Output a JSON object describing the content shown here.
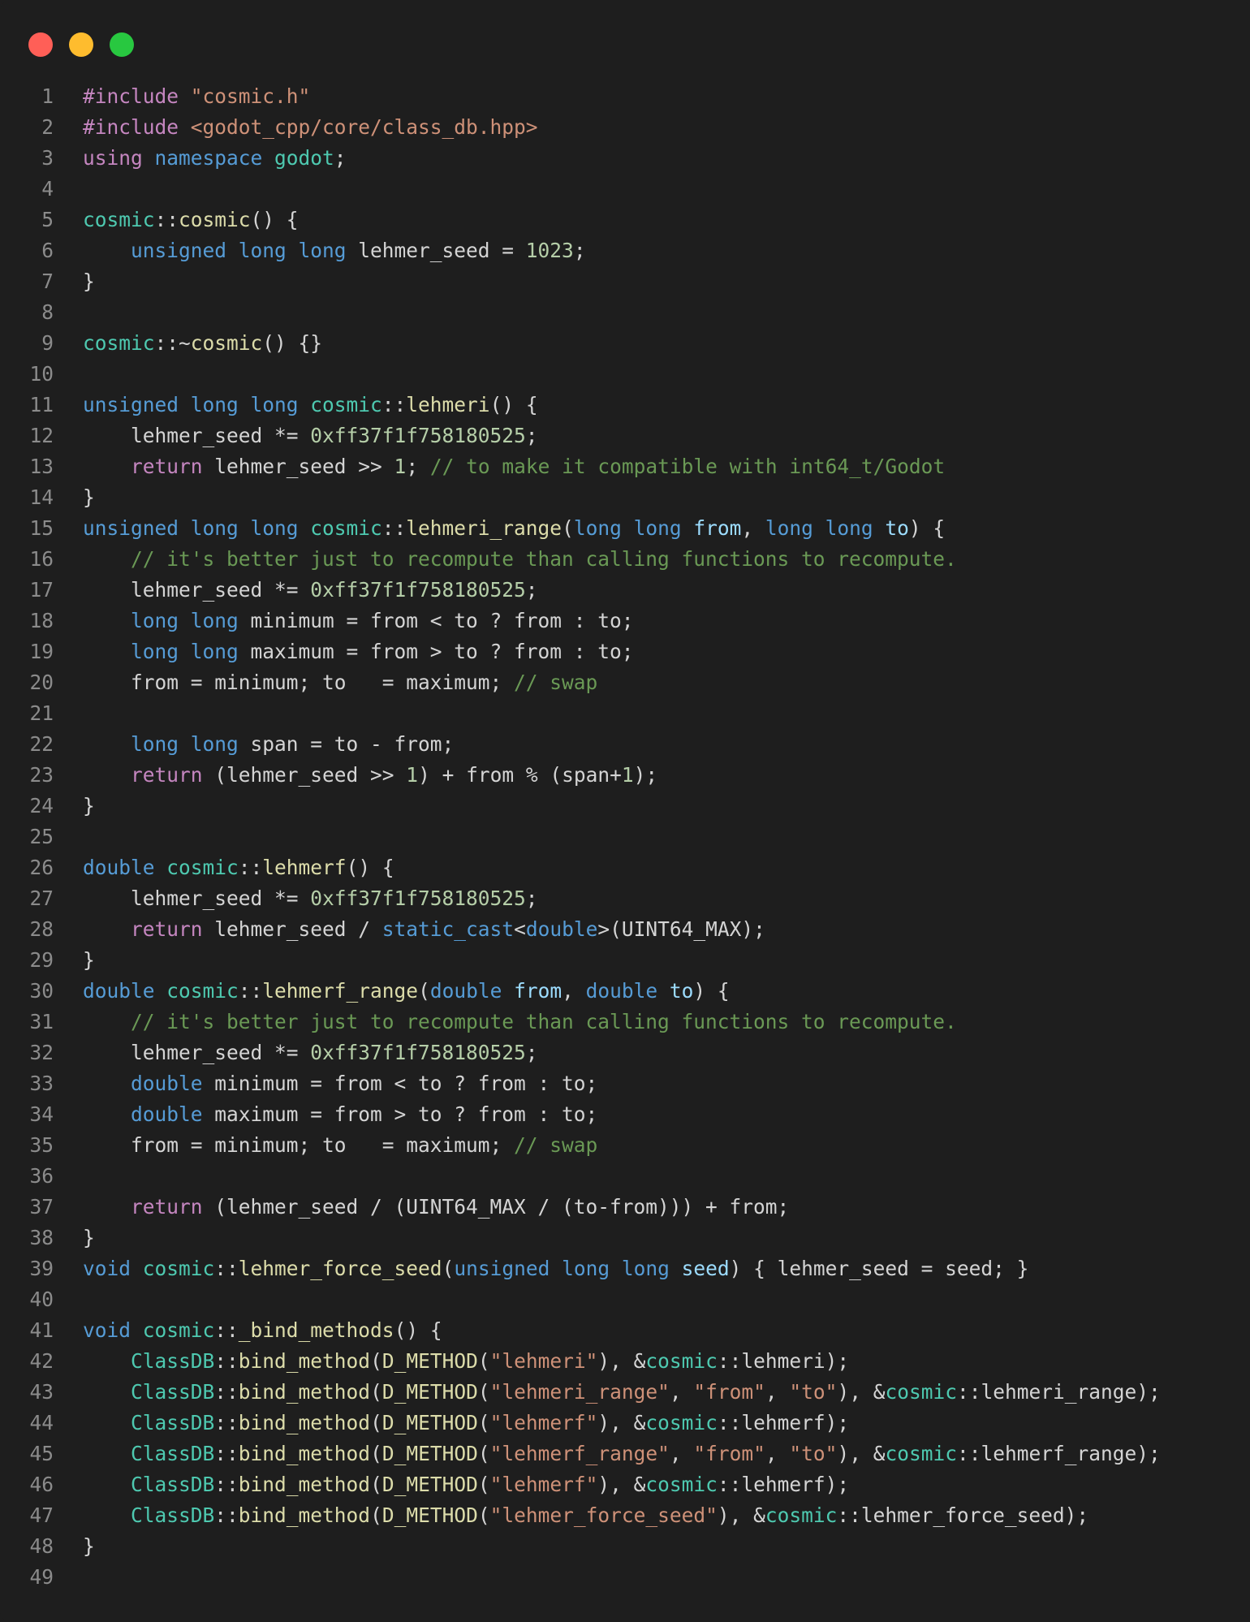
{
  "window": {
    "controls": [
      {
        "name": "close",
        "color": "#ff5f57"
      },
      {
        "name": "minimize",
        "color": "#febc2e"
      },
      {
        "name": "zoom",
        "color": "#28c840"
      }
    ]
  },
  "colors": {
    "background": "#1e1e1e",
    "keyword": "#c586c0",
    "type": "#569cd6",
    "namespace": "#4ec9b0",
    "function": "#dcdcaa",
    "string": "#ce9178",
    "number": "#b5cea8",
    "comment": "#6a9955",
    "variable": "#9cdcfe",
    "plain": "#d4d4d4",
    "line_number": "#8b8b8b"
  },
  "code": {
    "lines": [
      {
        "n": "1",
        "tokens": [
          [
            "kw",
            "#include "
          ],
          [
            "str",
            "\"cosmic.h\""
          ]
        ]
      },
      {
        "n": "2",
        "tokens": [
          [
            "kw",
            "#include "
          ],
          [
            "str",
            "<godot_cpp/core/class_db.hpp>"
          ]
        ]
      },
      {
        "n": "3",
        "tokens": [
          [
            "kw",
            "using "
          ],
          [
            "type",
            "namespace "
          ],
          [
            "ns",
            "godot"
          ],
          [
            "plain",
            ";"
          ]
        ]
      },
      {
        "n": "4",
        "tokens": []
      },
      {
        "n": "5",
        "tokens": [
          [
            "ns",
            "cosmic"
          ],
          [
            "plain",
            "::"
          ],
          [
            "fn",
            "cosmic"
          ],
          [
            "plain",
            "() {"
          ]
        ]
      },
      {
        "n": "6",
        "tokens": [
          [
            "plain",
            "    "
          ],
          [
            "type",
            "unsigned long long "
          ],
          [
            "plain",
            "lehmer_seed = "
          ],
          [
            "num",
            "1023"
          ],
          [
            "plain",
            ";"
          ]
        ]
      },
      {
        "n": "7",
        "tokens": [
          [
            "plain",
            "}"
          ]
        ]
      },
      {
        "n": "8",
        "tokens": []
      },
      {
        "n": "9",
        "tokens": [
          [
            "ns",
            "cosmic"
          ],
          [
            "plain",
            "::~"
          ],
          [
            "fn",
            "cosmic"
          ],
          [
            "plain",
            "() {}"
          ]
        ]
      },
      {
        "n": "10",
        "tokens": []
      },
      {
        "n": "11",
        "tokens": [
          [
            "type",
            "unsigned long long "
          ],
          [
            "ns",
            "cosmic"
          ],
          [
            "plain",
            "::"
          ],
          [
            "fn",
            "lehmeri"
          ],
          [
            "plain",
            "() {"
          ]
        ]
      },
      {
        "n": "12",
        "tokens": [
          [
            "plain",
            "    lehmer_seed *= "
          ],
          [
            "num",
            "0xff37f1f758180525"
          ],
          [
            "plain",
            ";"
          ]
        ]
      },
      {
        "n": "13",
        "tokens": [
          [
            "plain",
            "    "
          ],
          [
            "kw",
            "return "
          ],
          [
            "plain",
            "lehmer_seed >> "
          ],
          [
            "num",
            "1"
          ],
          [
            "plain",
            "; "
          ],
          [
            "cmt",
            "// to make it compatible with int64_t/Godot"
          ]
        ]
      },
      {
        "n": "14",
        "tokens": [
          [
            "plain",
            "}"
          ]
        ]
      },
      {
        "n": "15",
        "tokens": [
          [
            "type",
            "unsigned long long "
          ],
          [
            "ns",
            "cosmic"
          ],
          [
            "plain",
            "::"
          ],
          [
            "fn",
            "lehmeri_range"
          ],
          [
            "plain",
            "("
          ],
          [
            "type",
            "long long "
          ],
          [
            "var",
            "from"
          ],
          [
            "plain",
            ", "
          ],
          [
            "type",
            "long long "
          ],
          [
            "var",
            "to"
          ],
          [
            "plain",
            ") {"
          ]
        ]
      },
      {
        "n": "16",
        "tokens": [
          [
            "plain",
            "    "
          ],
          [
            "cmt",
            "// it's better just to recompute than calling functions to recompute."
          ]
        ]
      },
      {
        "n": "17",
        "tokens": [
          [
            "plain",
            "    lehmer_seed *= "
          ],
          [
            "num",
            "0xff37f1f758180525"
          ],
          [
            "plain",
            ";"
          ]
        ]
      },
      {
        "n": "18",
        "tokens": [
          [
            "plain",
            "    "
          ],
          [
            "type",
            "long long "
          ],
          [
            "plain",
            "minimum = from < to ? from : to;"
          ]
        ]
      },
      {
        "n": "19",
        "tokens": [
          [
            "plain",
            "    "
          ],
          [
            "type",
            "long long "
          ],
          [
            "plain",
            "maximum = from > to ? from : to;"
          ]
        ]
      },
      {
        "n": "20",
        "tokens": [
          [
            "plain",
            "    from = minimum; to   = maximum; "
          ],
          [
            "cmt",
            "// swap"
          ]
        ]
      },
      {
        "n": "21",
        "tokens": []
      },
      {
        "n": "22",
        "tokens": [
          [
            "plain",
            "    "
          ],
          [
            "type",
            "long long "
          ],
          [
            "plain",
            "span = to - from;"
          ]
        ]
      },
      {
        "n": "23",
        "tokens": [
          [
            "plain",
            "    "
          ],
          [
            "kw",
            "return "
          ],
          [
            "plain",
            "(lehmer_seed >> "
          ],
          [
            "num",
            "1"
          ],
          [
            "plain",
            ") + from % (span+"
          ],
          [
            "num",
            "1"
          ],
          [
            "plain",
            ");"
          ]
        ]
      },
      {
        "n": "24",
        "tokens": [
          [
            "plain",
            "}"
          ]
        ]
      },
      {
        "n": "25",
        "tokens": []
      },
      {
        "n": "26",
        "tokens": [
          [
            "type",
            "double "
          ],
          [
            "ns",
            "cosmic"
          ],
          [
            "plain",
            "::"
          ],
          [
            "fn",
            "lehmerf"
          ],
          [
            "plain",
            "() {"
          ]
        ]
      },
      {
        "n": "27",
        "tokens": [
          [
            "plain",
            "    lehmer_seed *= "
          ],
          [
            "num",
            "0xff37f1f758180525"
          ],
          [
            "plain",
            ";"
          ]
        ]
      },
      {
        "n": "28",
        "tokens": [
          [
            "plain",
            "    "
          ],
          [
            "kw",
            "return "
          ],
          [
            "plain",
            "lehmer_seed / "
          ],
          [
            "type",
            "static_cast"
          ],
          [
            "plain",
            "<"
          ],
          [
            "type",
            "double"
          ],
          [
            "plain",
            ">(UINT64_MAX);"
          ]
        ]
      },
      {
        "n": "29",
        "tokens": [
          [
            "plain",
            "}"
          ]
        ]
      },
      {
        "n": "30",
        "tokens": [
          [
            "type",
            "double "
          ],
          [
            "ns",
            "cosmic"
          ],
          [
            "plain",
            "::"
          ],
          [
            "fn",
            "lehmerf_range"
          ],
          [
            "plain",
            "("
          ],
          [
            "type",
            "double "
          ],
          [
            "var",
            "from"
          ],
          [
            "plain",
            ", "
          ],
          [
            "type",
            "double "
          ],
          [
            "var",
            "to"
          ],
          [
            "plain",
            ") {"
          ]
        ]
      },
      {
        "n": "31",
        "tokens": [
          [
            "plain",
            "    "
          ],
          [
            "cmt",
            "// it's better just to recompute than calling functions to recompute."
          ]
        ]
      },
      {
        "n": "32",
        "tokens": [
          [
            "plain",
            "    lehmer_seed *= "
          ],
          [
            "num",
            "0xff37f1f758180525"
          ],
          [
            "plain",
            ";"
          ]
        ]
      },
      {
        "n": "33",
        "tokens": [
          [
            "plain",
            "    "
          ],
          [
            "type",
            "double "
          ],
          [
            "plain",
            "minimum = from < to ? from : to;"
          ]
        ]
      },
      {
        "n": "34",
        "tokens": [
          [
            "plain",
            "    "
          ],
          [
            "type",
            "double "
          ],
          [
            "plain",
            "maximum = from > to ? from : to;"
          ]
        ]
      },
      {
        "n": "35",
        "tokens": [
          [
            "plain",
            "    from = minimum; to   = maximum; "
          ],
          [
            "cmt",
            "// swap"
          ]
        ]
      },
      {
        "n": "36",
        "tokens": []
      },
      {
        "n": "37",
        "tokens": [
          [
            "plain",
            "    "
          ],
          [
            "kw",
            "return "
          ],
          [
            "plain",
            "(lehmer_seed / (UINT64_MAX / (to-from))) + from;"
          ]
        ]
      },
      {
        "n": "38",
        "tokens": [
          [
            "plain",
            "}"
          ]
        ]
      },
      {
        "n": "39",
        "tokens": [
          [
            "type",
            "void "
          ],
          [
            "ns",
            "cosmic"
          ],
          [
            "plain",
            "::"
          ],
          [
            "fn",
            "lehmer_force_seed"
          ],
          [
            "plain",
            "("
          ],
          [
            "type",
            "unsigned long long "
          ],
          [
            "var",
            "seed"
          ],
          [
            "plain",
            ") { lehmer_seed = seed; }"
          ]
        ]
      },
      {
        "n": "40",
        "tokens": []
      },
      {
        "n": "41",
        "tokens": [
          [
            "type",
            "void "
          ],
          [
            "ns",
            "cosmic"
          ],
          [
            "plain",
            "::"
          ],
          [
            "fn",
            "_bind_methods"
          ],
          [
            "plain",
            "() {"
          ]
        ]
      },
      {
        "n": "42",
        "tokens": [
          [
            "plain",
            "    "
          ],
          [
            "ns",
            "ClassDB"
          ],
          [
            "plain",
            "::"
          ],
          [
            "fn",
            "bind_method"
          ],
          [
            "plain",
            "("
          ],
          [
            "fn",
            "D_METHOD"
          ],
          [
            "plain",
            "("
          ],
          [
            "str",
            "\"lehmeri\""
          ],
          [
            "plain",
            "), &"
          ],
          [
            "ns",
            "cosmic"
          ],
          [
            "plain",
            "::lehmeri);"
          ]
        ]
      },
      {
        "n": "43",
        "tokens": [
          [
            "plain",
            "    "
          ],
          [
            "ns",
            "ClassDB"
          ],
          [
            "plain",
            "::"
          ],
          [
            "fn",
            "bind_method"
          ],
          [
            "plain",
            "("
          ],
          [
            "fn",
            "D_METHOD"
          ],
          [
            "plain",
            "("
          ],
          [
            "str",
            "\"lehmeri_range\""
          ],
          [
            "plain",
            ", "
          ],
          [
            "str",
            "\"from\""
          ],
          [
            "plain",
            ", "
          ],
          [
            "str",
            "\"to\""
          ],
          [
            "plain",
            "), &"
          ],
          [
            "ns",
            "cosmic"
          ],
          [
            "plain",
            "::lehmeri_range);"
          ]
        ]
      },
      {
        "n": "44",
        "tokens": [
          [
            "plain",
            "    "
          ],
          [
            "ns",
            "ClassDB"
          ],
          [
            "plain",
            "::"
          ],
          [
            "fn",
            "bind_method"
          ],
          [
            "plain",
            "("
          ],
          [
            "fn",
            "D_METHOD"
          ],
          [
            "plain",
            "("
          ],
          [
            "str",
            "\"lehmerf\""
          ],
          [
            "plain",
            "), &"
          ],
          [
            "ns",
            "cosmic"
          ],
          [
            "plain",
            "::lehmerf);"
          ]
        ]
      },
      {
        "n": "45",
        "tokens": [
          [
            "plain",
            "    "
          ],
          [
            "ns",
            "ClassDB"
          ],
          [
            "plain",
            "::"
          ],
          [
            "fn",
            "bind_method"
          ],
          [
            "plain",
            "("
          ],
          [
            "fn",
            "D_METHOD"
          ],
          [
            "plain",
            "("
          ],
          [
            "str",
            "\"lehmerf_range\""
          ],
          [
            "plain",
            ", "
          ],
          [
            "str",
            "\"from\""
          ],
          [
            "plain",
            ", "
          ],
          [
            "str",
            "\"to\""
          ],
          [
            "plain",
            "), &"
          ],
          [
            "ns",
            "cosmic"
          ],
          [
            "plain",
            "::lehmerf_range);"
          ]
        ]
      },
      {
        "n": "46",
        "tokens": [
          [
            "plain",
            "    "
          ],
          [
            "ns",
            "ClassDB"
          ],
          [
            "plain",
            "::"
          ],
          [
            "fn",
            "bind_method"
          ],
          [
            "plain",
            "("
          ],
          [
            "fn",
            "D_METHOD"
          ],
          [
            "plain",
            "("
          ],
          [
            "str",
            "\"lehmerf\""
          ],
          [
            "plain",
            "), &"
          ],
          [
            "ns",
            "cosmic"
          ],
          [
            "plain",
            "::lehmerf);"
          ]
        ]
      },
      {
        "n": "47",
        "tokens": [
          [
            "plain",
            "    "
          ],
          [
            "ns",
            "ClassDB"
          ],
          [
            "plain",
            "::"
          ],
          [
            "fn",
            "bind_method"
          ],
          [
            "plain",
            "("
          ],
          [
            "fn",
            "D_METHOD"
          ],
          [
            "plain",
            "("
          ],
          [
            "str",
            "\"lehmer_force_seed\""
          ],
          [
            "plain",
            "), &"
          ],
          [
            "ns",
            "cosmic"
          ],
          [
            "plain",
            "::lehmer_force_seed);"
          ]
        ]
      },
      {
        "n": "48",
        "tokens": [
          [
            "plain",
            "}"
          ]
        ]
      },
      {
        "n": "49",
        "tokens": []
      }
    ]
  }
}
